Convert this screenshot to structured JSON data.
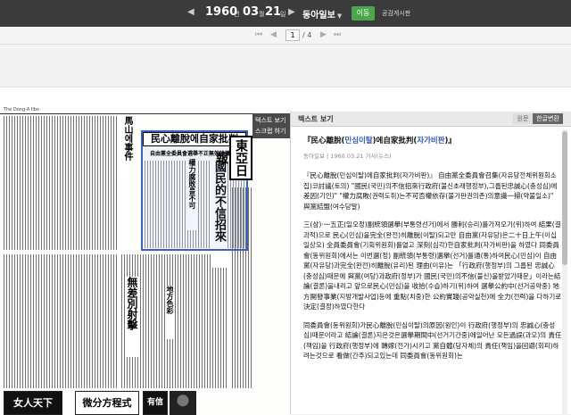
{
  "toolbar": {
    "year": "1960",
    "month": "03",
    "day": "21",
    "year_unit": "년",
    "month_unit": "월",
    "day_unit": "일",
    "newspaper": "동아일보",
    "go_label": "이동",
    "share_label": "공감게시판"
  },
  "pager": {
    "current": "1",
    "total": "/ 4"
  },
  "side_tab": {
    "line1": "텍스트 보기",
    "line2": "스크랩 하기"
  },
  "newspaper_page": {
    "top_header": "The Dong-A Ilbo",
    "headline": "民心離脫에自家批判",
    "subhead": "自由黨全委員會選舉不正無效論議",
    "masthead": "東亞日報",
    "vheads": [
      "國民的不信招來",
      "權力腐敗를不可",
      "無差別射擊",
      "馬山에事件",
      "地方色彩"
    ],
    "ads": [
      "女人天下",
      "微分方程式",
      "有信"
    ]
  },
  "panel": {
    "title": "텍스트 보기",
    "toggle_original": "원문",
    "toggle_korean": "한글변환",
    "article_title_pre": "『民心離脫(",
    "article_title_kw1": "민심이탈",
    "article_title_mid": ")에自家批判(",
    "article_title_kw2": "자가비판",
    "article_title_post": ")』",
    "meta": "동아일보 | 1960.03.21 기사(뉴스)",
    "para1": "『民心離脫(민심이탈)에自家批判(자가비판)』 自由黨全委員會召集(자유당전체위원회소집)코討議(토의) \"國民(국민)의不信招來行政府(불신초래행정부),그룹된忠誠心(충성심)에差因(기인)\" \"權力腐敗(권력도취)는不可否權依存(불가판권의존)의意識一掃(약불일소)\" 與黨結盟(여수당말)",
    "para2": "三(삼)·一五正(일오정)副統領選擧(부통령선거)에서 勝利(승리)를가져오기(위)하여 結果(결과적)으로 民心(민심)을完全(완전)히離脫(이탈)되고만 自由黨(자유당)은二十日上午(이십일상오) 全員委員會(기획위원회)를열고 深刻(심각)한自家批判(자가비판)을 하였다 同委員會(동위원회)에서는 이번選(정) 副統領(부통령)選擧(선거)를通(통)하여民心(민심)이 自由黨(자유당)과完全(완전)히離脫(유리)된 理由(이유)는 「行政府(행정부)의 그룹된 忠誠心(충성심)때문에 與黨(여당)과政府(정부)가 國民(국민)의不信(불신)을받았기때문」이라는結論(결론)을내리고 앞으로民心(민심)을 收拾(수습)하기(위)하여 選擧公約中(선거공약중) 地方開發事業(지방개발사업)등에 重點(치중)한 公約實踐(공약실천)에 全力(전력)을 다하기로 決定(결정)하였다한다",
    "para3": "同委員會(동위원회)가民心離脫(민심이탈)의原因(원인)이 行政府(행정부)의 忠誠心(충성심)때문이라고 結論(결론)지은것은選擧期間中(선거기간중)에일어난 모든過誤(과오)의 責任(책임)을 行政府(행정부)에 轉嫁(전가)시키고 黨自體(당자체)의 責任(책임)을回避(회피)하려는것으로 看做(간주)되고있는데 同委員會(동위원회)는"
  },
  "colors": {
    "accent": "#4aa84a",
    "highlight": "#3a63b8",
    "keyword": "#2f57b0"
  }
}
